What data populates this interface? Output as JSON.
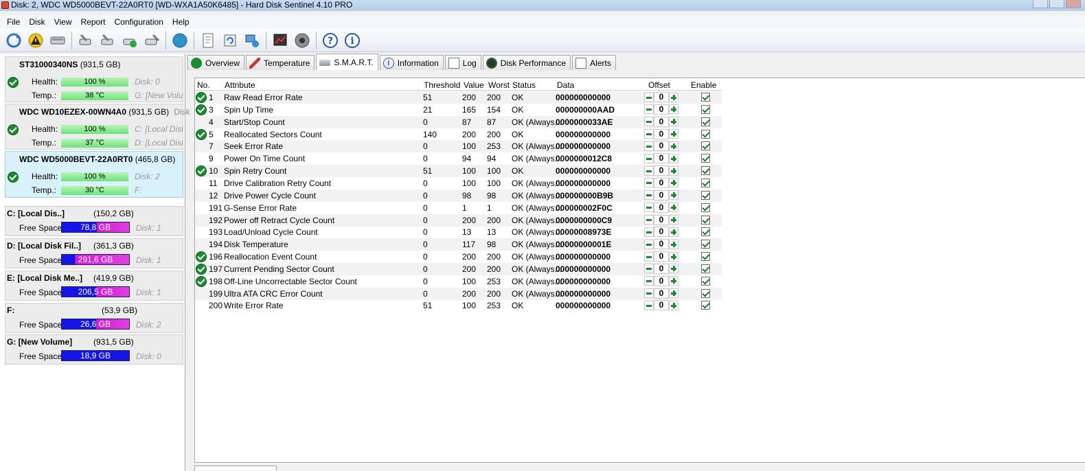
{
  "window": {
    "title": "Disk: 2, WDC WD5000BEVT-22A0RT0 [WD-WXA1A50K6485]  -  Hard Disk Sentinel 4.10 PRO"
  },
  "menu": [
    "File",
    "Disk",
    "View",
    "Report",
    "Configuration",
    "Help"
  ],
  "toolbar_icons": [
    "refresh-icon",
    "warning-icon",
    "disk-icon",
    "disk-tool-1-icon",
    "disk-tool-2-icon",
    "disk-tool-3-icon",
    "disk-tool-4-icon",
    "globe-icon",
    "report-icon",
    "sync-icon",
    "network-icon",
    "chart-icon",
    "speaker-icon",
    "help-icon",
    "info-icon"
  ],
  "disks": [
    {
      "name": "ST31000340NS",
      "size": "(931,5 GB)",
      "disk_no": "Disk: 0",
      "health_label": "Health:",
      "health": "100 %",
      "health_pct": 100,
      "temp_label": "Temp.:",
      "temp": "38 °C",
      "extra": "G: [New Volu"
    },
    {
      "name": "WDC WD10EZEX-00WN4A0",
      "size": "(931,5 GB)",
      "disk_no": "Disk",
      "health_label": "Health:",
      "health": "100 %",
      "health_pct": 100,
      "health_extra": "C: [Local Disk",
      "temp_label": "Temp.:",
      "temp": "37 °C",
      "extra": "D: [Local Disk"
    },
    {
      "name": "WDC WD5000BEVT-22A0RT0",
      "size": "(465,8 GB)",
      "disk_no": "Disk: 2",
      "health_label": "Health:",
      "health": "100 %",
      "health_pct": 100,
      "temp_label": "Temp.:",
      "temp": "30 °C",
      "extra": "F:"
    }
  ],
  "volumes": [
    {
      "name": "C: [Local Dis..]",
      "size": "(150,2 GB)",
      "label": "Free Space",
      "free": "78,8 GB",
      "free_pct": 52,
      "disk": "Disk: 1"
    },
    {
      "name": "D: [Local Disk Fil..]",
      "size": "(361,3 GB)",
      "label": "Free Space",
      "free": "291,6 GB",
      "free_pct": 20,
      "disk": "Disk: 1"
    },
    {
      "name": "E: [Local Disk Me..]",
      "size": "(419,9 GB)",
      "label": "Free Space",
      "free": "206,5 GB",
      "free_pct": 51,
      "disk": "Disk: 1"
    },
    {
      "name": "F:",
      "size": "(53,9 GB)",
      "label": "Free Space",
      "free": "26,6 GB",
      "free_pct": 51,
      "disk": "Disk: 2"
    },
    {
      "name": "G: [New Volume]",
      "size": "(931,5 GB)",
      "label": "Free Space",
      "free": "18,9 GB",
      "free_pct": 100,
      "disk": "Disk: 0"
    }
  ],
  "tabs": [
    {
      "label": "Overview",
      "icon": "check-icon"
    },
    {
      "label": "Temperature",
      "icon": "thermometer-icon"
    },
    {
      "label": "S.M.A.R.T.",
      "icon": "smart-icon",
      "active": true
    },
    {
      "label": "Information",
      "icon": "info-icon"
    },
    {
      "label": "Log",
      "icon": "log-icon"
    },
    {
      "label": "Disk Performance",
      "icon": "performance-icon"
    },
    {
      "label": "Alerts",
      "icon": "alerts-icon"
    }
  ],
  "smart": {
    "headers": {
      "no": "No.",
      "attribute": "Attribute",
      "threshold": "Threshold",
      "value": "Value",
      "worst": "Worst",
      "status": "Status",
      "data": "Data",
      "offset": "Offset",
      "enable": "Enable"
    },
    "rows": [
      {
        "no": "1",
        "check": true,
        "attribute": "Raw Read Error Rate",
        "threshold": "51",
        "value": "200",
        "worst": "200",
        "status": "OK",
        "data": "000000000000",
        "offset": "0"
      },
      {
        "no": "3",
        "check": true,
        "attribute": "Spin Up Time",
        "threshold": "21",
        "value": "165",
        "worst": "154",
        "status": "OK",
        "data": "000000000AAD",
        "offset": "0"
      },
      {
        "no": "4",
        "check": false,
        "attribute": "Start/Stop Count",
        "threshold": "0",
        "value": "87",
        "worst": "87",
        "status": "OK (Always...",
        "data": "0000000033AE",
        "offset": "0"
      },
      {
        "no": "5",
        "check": true,
        "attribute": "Reallocated Sectors Count",
        "threshold": "140",
        "value": "200",
        "worst": "200",
        "status": "OK",
        "data": "000000000000",
        "offset": "0"
      },
      {
        "no": "7",
        "check": false,
        "attribute": "Seek Error Rate",
        "threshold": "0",
        "value": "100",
        "worst": "253",
        "status": "OK (Always...",
        "data": "000000000000",
        "offset": "0"
      },
      {
        "no": "9",
        "check": false,
        "attribute": "Power On Time Count",
        "threshold": "0",
        "value": "94",
        "worst": "94",
        "status": "OK (Always...",
        "data": "0000000012C8",
        "offset": "0"
      },
      {
        "no": "10",
        "check": true,
        "attribute": "Spin Retry Count",
        "threshold": "51",
        "value": "100",
        "worst": "100",
        "status": "OK",
        "data": "000000000000",
        "offset": "0"
      },
      {
        "no": "11",
        "check": false,
        "attribute": "Drive Calibration Retry Count",
        "threshold": "0",
        "value": "100",
        "worst": "100",
        "status": "OK (Always...",
        "data": "000000000000",
        "offset": "0"
      },
      {
        "no": "12",
        "check": false,
        "attribute": "Drive Power Cycle Count",
        "threshold": "0",
        "value": "98",
        "worst": "98",
        "status": "OK (Always...",
        "data": "000000000B9B",
        "offset": "0"
      },
      {
        "no": "191",
        "check": false,
        "attribute": "G-Sense Error Rate",
        "threshold": "0",
        "value": "1",
        "worst": "1",
        "status": "OK (Always...",
        "data": "000000002F0C",
        "offset": "0"
      },
      {
        "no": "192",
        "check": false,
        "attribute": "Power off Retract Cycle Count",
        "threshold": "0",
        "value": "200",
        "worst": "200",
        "status": "OK (Always...",
        "data": "0000000000C9",
        "offset": "0"
      },
      {
        "no": "193",
        "check": false,
        "attribute": "Load/Unload Cycle Count",
        "threshold": "0",
        "value": "13",
        "worst": "13",
        "status": "OK (Always...",
        "data": "00000008973E",
        "offset": "0"
      },
      {
        "no": "194",
        "check": false,
        "attribute": "Disk Temperature",
        "threshold": "0",
        "value": "117",
        "worst": "98",
        "status": "OK (Always...",
        "data": "00000000001E",
        "offset": "0"
      },
      {
        "no": "196",
        "check": true,
        "attribute": "Reallocation Event Count",
        "threshold": "0",
        "value": "200",
        "worst": "200",
        "status": "OK (Always...",
        "data": "000000000000",
        "offset": "0"
      },
      {
        "no": "197",
        "check": true,
        "attribute": "Current Pending Sector Count",
        "threshold": "0",
        "value": "200",
        "worst": "200",
        "status": "OK (Always...",
        "data": "000000000000",
        "offset": "0"
      },
      {
        "no": "198",
        "check": true,
        "attribute": "Off-Line Uncorrectable Sector Count",
        "threshold": "0",
        "value": "100",
        "worst": "253",
        "status": "OK (Always...",
        "data": "000000000000",
        "offset": "0"
      },
      {
        "no": "199",
        "check": false,
        "attribute": "Ultra ATA CRC Error Count",
        "threshold": "0",
        "value": "200",
        "worst": "200",
        "status": "OK (Always...",
        "data": "000000000000",
        "offset": "0"
      },
      {
        "no": "200",
        "check": false,
        "attribute": "Write Error Rate",
        "threshold": "51",
        "value": "100",
        "worst": "253",
        "status": "OK",
        "data": "000000000000",
        "offset": "0"
      }
    ]
  }
}
